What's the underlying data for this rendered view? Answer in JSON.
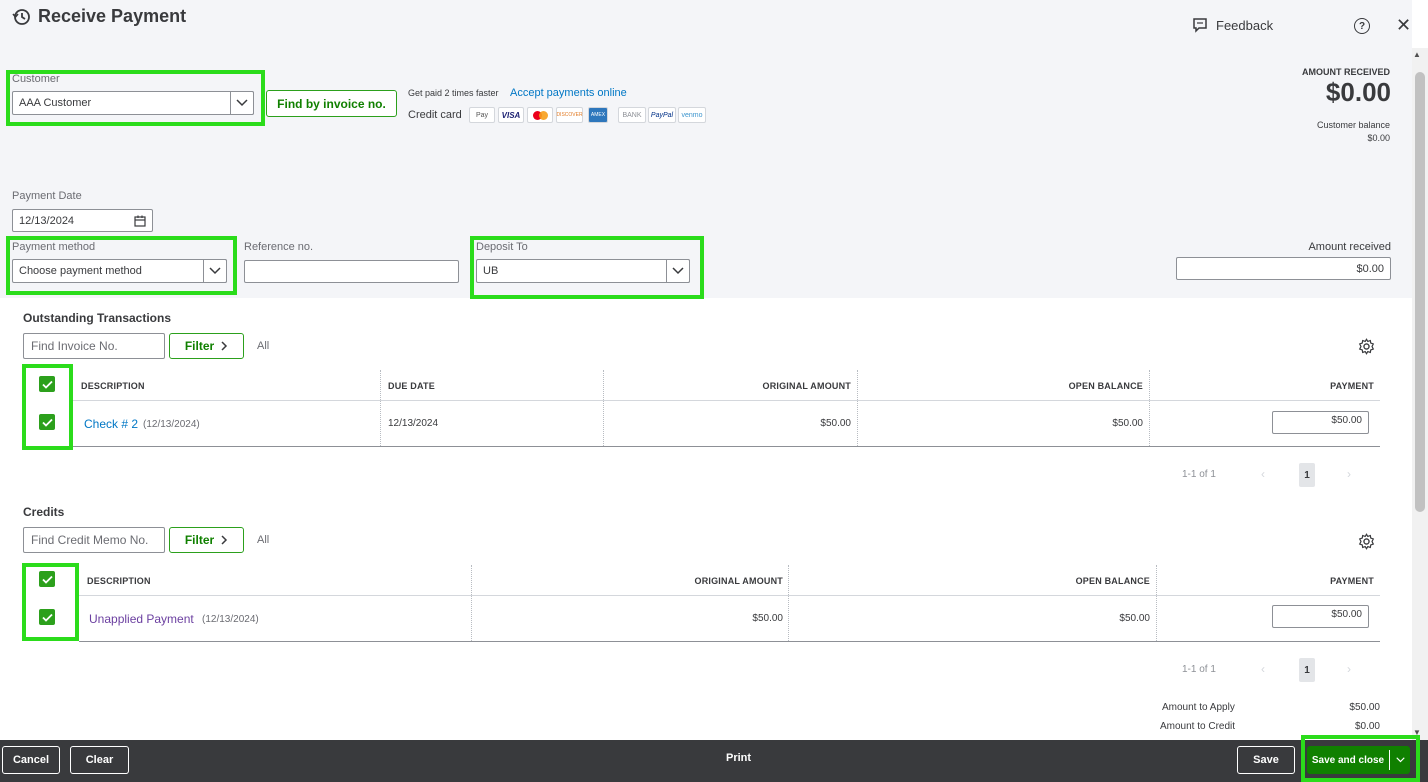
{
  "header": {
    "title": "Receive Payment",
    "feedback_label": "Feedback"
  },
  "customer": {
    "label": "Customer",
    "value": "AAA Customer",
    "find_by_invoice_label": "Find by invoice no."
  },
  "promo": {
    "get_paid_text": "Get paid 2 times faster",
    "accept_link": "Accept payments online",
    "credit_card_label": "Credit card",
    "cards": [
      "Pay",
      "VISA",
      "",
      "DISCOVER",
      "AMEX",
      "BANK",
      "PayPal",
      "venmo"
    ]
  },
  "summary": {
    "amount_received_label": "AMOUNT RECEIVED",
    "amount_received_value": "$0.00",
    "customer_balance_label": "Customer balance",
    "customer_balance_value": "$0.00"
  },
  "payment_date": {
    "label": "Payment Date",
    "value": "12/13/2024"
  },
  "payment_method": {
    "label": "Payment method",
    "placeholder": "Choose payment method"
  },
  "reference": {
    "label": "Reference no.",
    "value": ""
  },
  "deposit_to": {
    "label": "Deposit To",
    "value": "UB"
  },
  "amount_received_field": {
    "label": "Amount received",
    "value": "$0.00"
  },
  "outstanding": {
    "title": "Outstanding Transactions",
    "search_placeholder": "Find Invoice No.",
    "filter_label": "Filter",
    "all_label": "All",
    "columns": [
      "DESCRIPTION",
      "DUE DATE",
      "ORIGINAL AMOUNT",
      "OPEN BALANCE",
      "PAYMENT"
    ],
    "rows": [
      {
        "description": "Check # 2",
        "date": "(12/13/2024)",
        "due_date": "12/13/2024",
        "original": "$50.00",
        "open": "$50.00",
        "payment": "$50.00"
      }
    ],
    "pager_text": "1-1 of 1",
    "page": "1"
  },
  "credits": {
    "title": "Credits",
    "search_placeholder": "Find Credit Memo No.",
    "filter_label": "Filter",
    "all_label": "All",
    "columns": [
      "DESCRIPTION",
      "ORIGINAL AMOUNT",
      "OPEN BALANCE",
      "PAYMENT"
    ],
    "rows": [
      {
        "description": "Unapplied Payment",
        "date": "(12/13/2024)",
        "original": "$50.00",
        "open": "$50.00",
        "payment": "$50.00"
      }
    ],
    "pager_text": "1-1 of 1",
    "page": "1"
  },
  "totals": {
    "amount_to_apply_label": "Amount to Apply",
    "amount_to_apply_value": "$50.00",
    "amount_to_credit_label": "Amount to Credit",
    "amount_to_credit_value": "$0.00"
  },
  "footer": {
    "cancel_label": "Cancel",
    "clear_label": "Clear",
    "print_label": "Print",
    "save_label": "Save",
    "save_close_label": "Save and close"
  },
  "colors": {
    "accent_green": "#2ca01c",
    "highlight_green": "#2bdc1b",
    "link_blue": "#0077c5",
    "footer_bg": "#393a3d"
  }
}
